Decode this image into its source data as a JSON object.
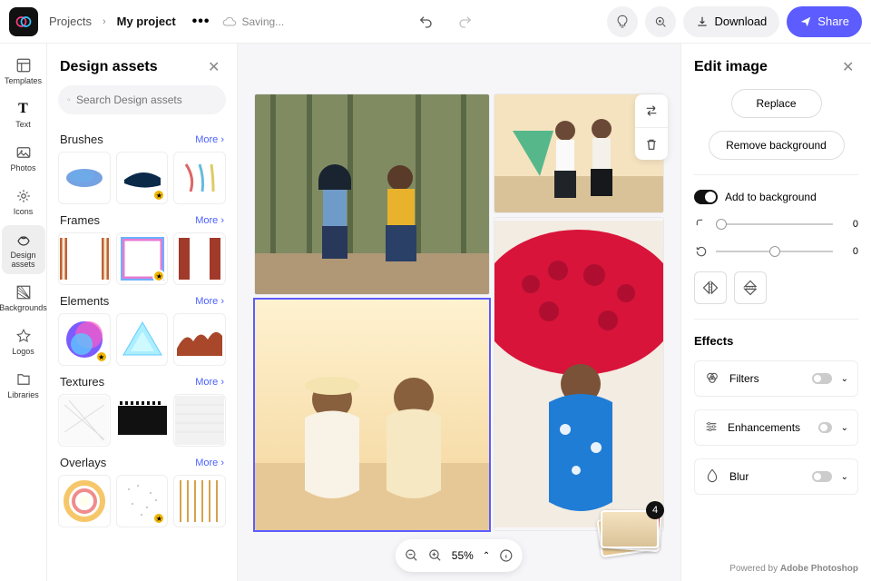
{
  "topbar": {
    "breadcrumb_root": "Projects",
    "breadcrumb_current": "My project",
    "saving_label": "Saving...",
    "download_label": "Download",
    "share_label": "Share"
  },
  "rail": {
    "items": [
      {
        "label": "Templates"
      },
      {
        "label": "Text"
      },
      {
        "label": "Photos"
      },
      {
        "label": "Icons"
      },
      {
        "label": "Design assets"
      },
      {
        "label": "Backgrounds"
      },
      {
        "label": "Logos"
      },
      {
        "label": "Libraries"
      }
    ]
  },
  "panel": {
    "title": "Design assets",
    "search_placeholder": "Search Design assets",
    "more_label": "More",
    "categories": [
      "Brushes",
      "Frames",
      "Elements",
      "Textures",
      "Overlays"
    ]
  },
  "canvas": {
    "stack_count": "4",
    "zoom": "55%"
  },
  "edit": {
    "title": "Edit image",
    "replace_label": "Replace",
    "remove_bg_label": "Remove background",
    "add_bg_label": "Add to background",
    "slider_round": "0",
    "slider_rotate": "0",
    "effects_title": "Effects",
    "filters_label": "Filters",
    "enhancements_label": "Enhancements",
    "blur_label": "Blur",
    "powered_prefix": "Powered by ",
    "powered_brand": "Adobe Photoshop"
  }
}
